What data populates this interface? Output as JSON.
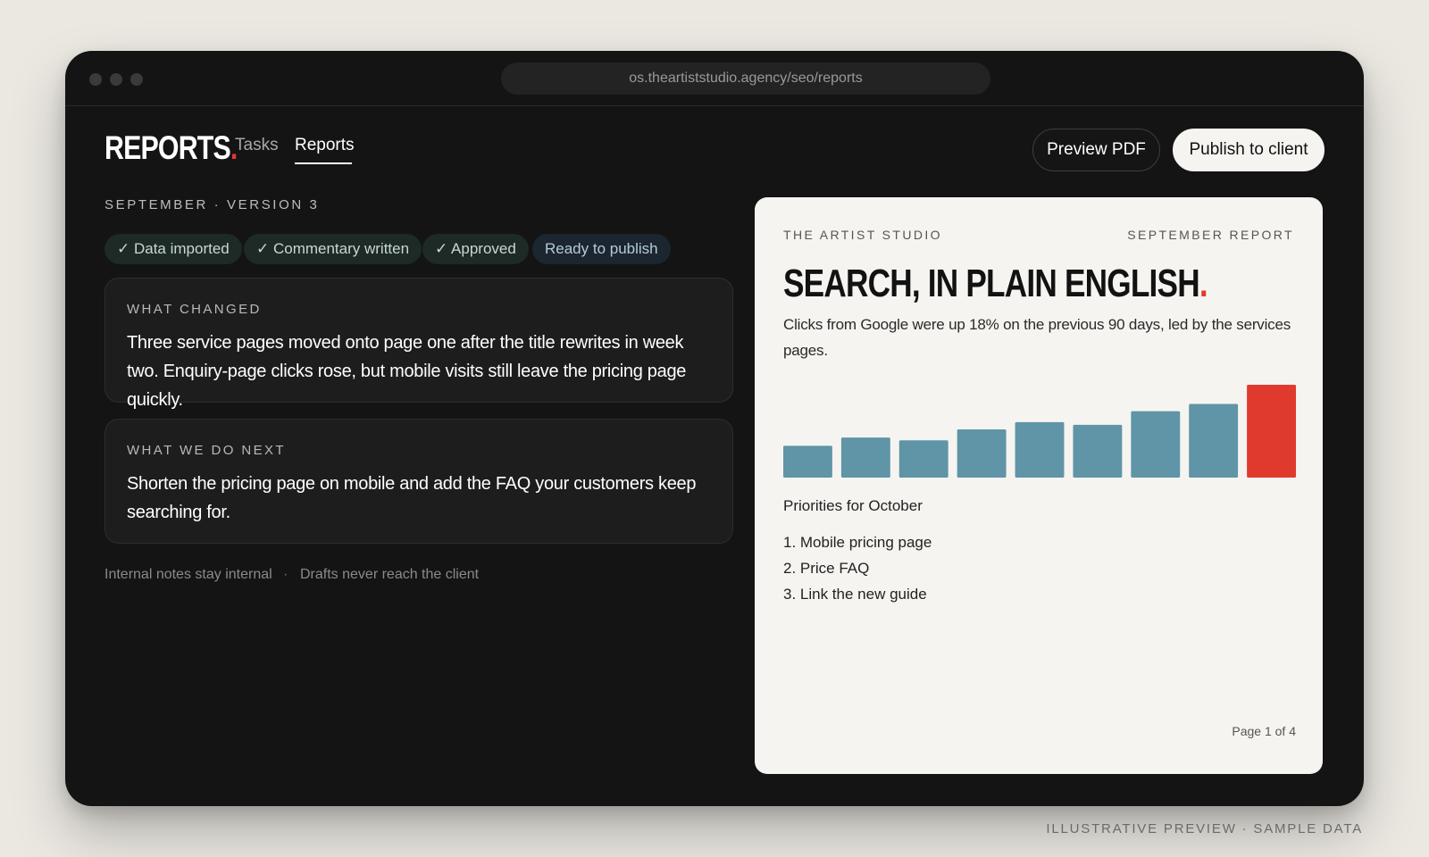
{
  "browser": {
    "url": "os.theartiststudio.agency/seo/reports"
  },
  "header": {
    "logo_text": "REPORTS",
    "logo_dot": ".",
    "tabs": [
      {
        "label": "Tasks",
        "active": false
      },
      {
        "label": "Reports",
        "active": true
      }
    ],
    "preview_label": "Preview PDF",
    "publish_label": "Publish to client"
  },
  "main": {
    "version_label": "SEPTEMBER · VERSION 3",
    "statuses": [
      {
        "label": "✓ Data imported"
      },
      {
        "label": "✓ Commentary written"
      },
      {
        "label": "✓ Approved"
      },
      {
        "label": "Ready to publish"
      }
    ],
    "cards": [
      {
        "label": "WHAT CHANGED",
        "text": "Three service pages moved onto page one after the title rewrites in week two. Enquiry-page clicks rose, but mobile visits still leave the pricing page quickly."
      },
      {
        "label": "WHAT WE DO NEXT",
        "text": "Shorten the pricing page on mobile and add the FAQ your customers keep searching for."
      }
    ],
    "footnotes": [
      "Internal notes stay internal",
      "·",
      "Drafts never reach the client"
    ]
  },
  "report": {
    "brand": "THE ARTIST STUDIO",
    "month": "SEPTEMBER REPORT",
    "title": "SEARCH, IN PLAIN ENGLISH",
    "title_dot": ".",
    "summary": "Clicks from Google were up 18% on the previous 90 days, led by the services pages.",
    "priorities_heading": "Priorities for October",
    "priorities": [
      "1. Mobile pricing page",
      "2. Price FAQ",
      "3. Link the new guide"
    ],
    "page_indicator": "Page 1 of 4"
  },
  "chart_data": {
    "type": "bar",
    "values": [
      35,
      44,
      41,
      53,
      61,
      58,
      73,
      81,
      102
    ],
    "highlight_index": 8,
    "colors": {
      "bar": "#5f95a6",
      "highlight": "#e03a2f"
    },
    "ylim": [
      0,
      104
    ],
    "title": "",
    "xlabel": "",
    "ylabel": ""
  },
  "caption": "ILLUSTRATIVE PREVIEW · SAMPLE DATA",
  "colors": {
    "accent": "#e03a2f",
    "window_bg": "#141414",
    "page_bg": "#ebe8e2",
    "report_bg": "#f6f4f0"
  }
}
